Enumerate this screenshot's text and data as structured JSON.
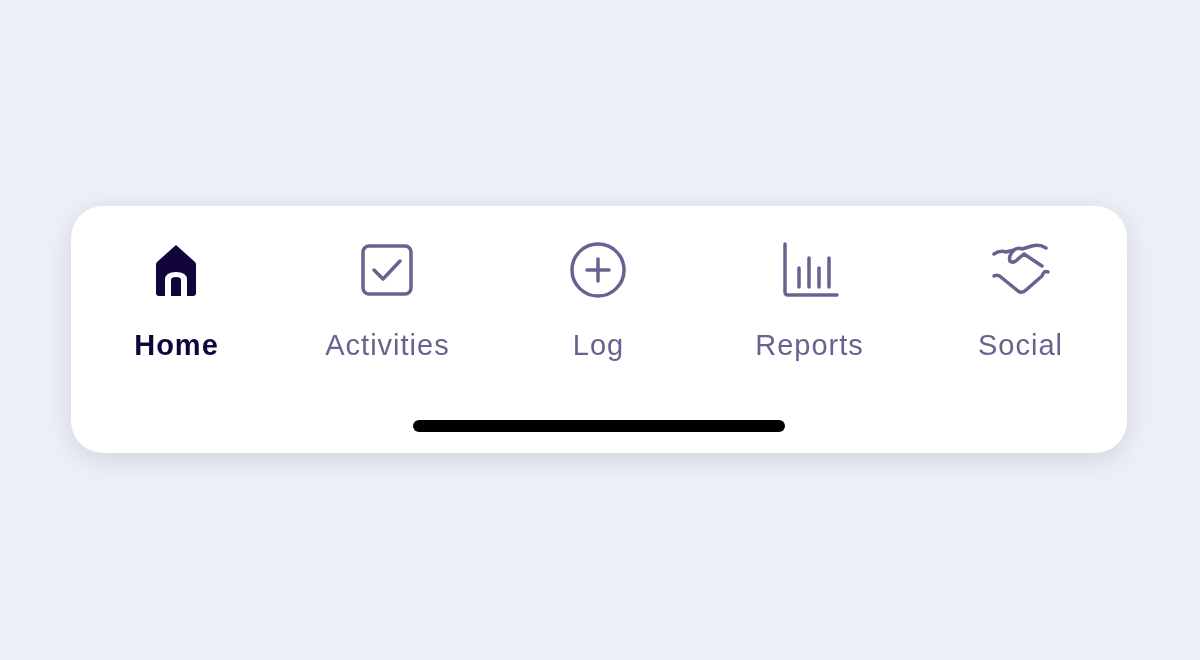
{
  "tab_bar": {
    "tabs": [
      {
        "label": "Home",
        "selected": true
      },
      {
        "label": "Activities",
        "selected": false
      },
      {
        "label": "Log",
        "selected": false
      },
      {
        "label": "Reports",
        "selected": false
      },
      {
        "label": "Social",
        "selected": false
      }
    ]
  }
}
